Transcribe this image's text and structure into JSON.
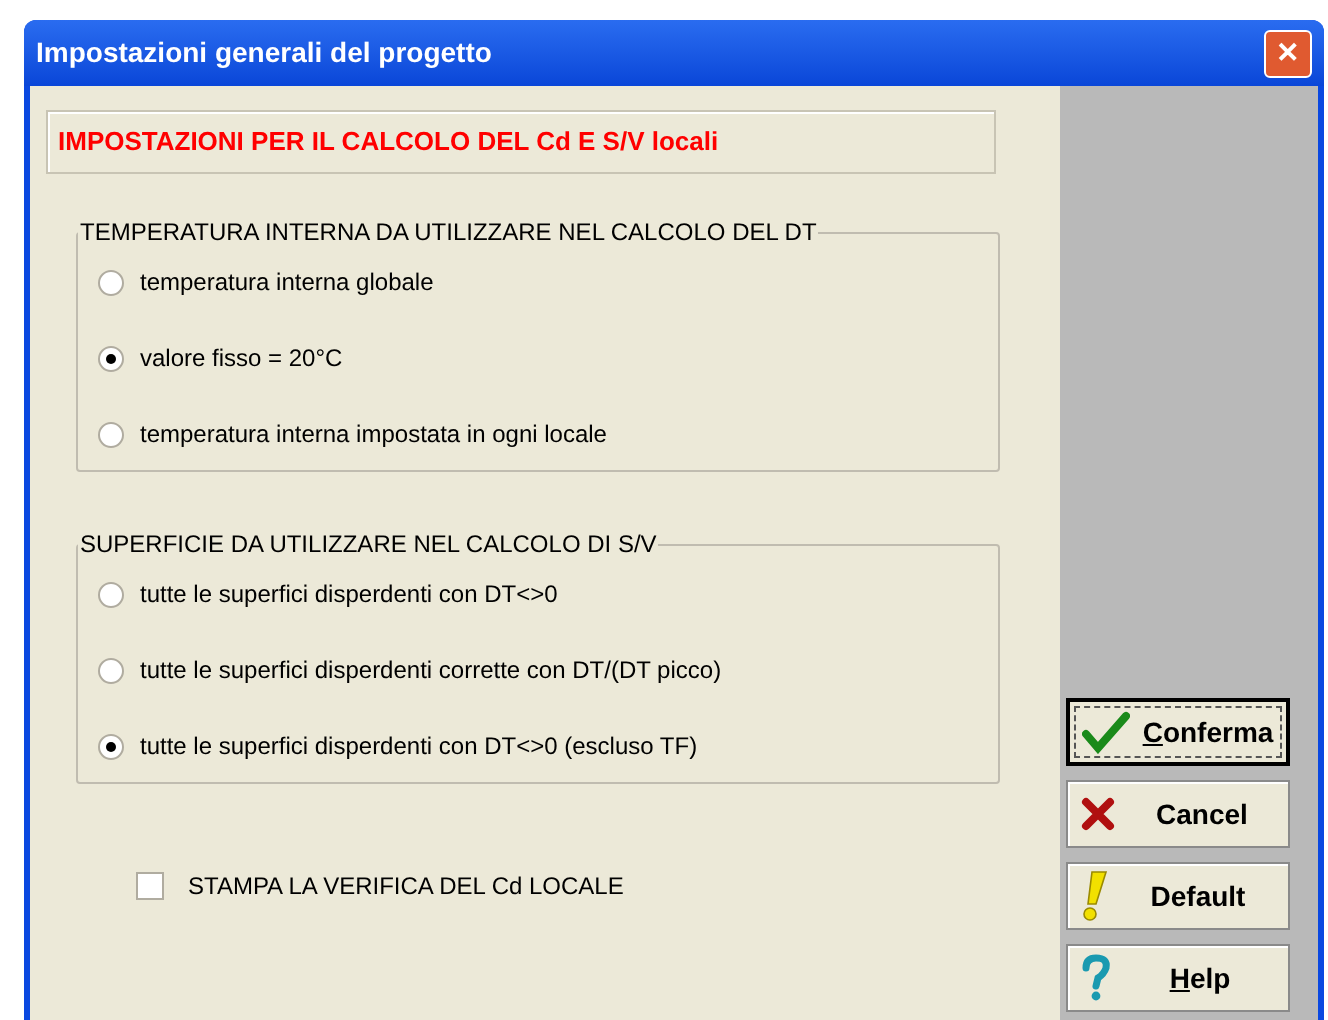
{
  "window": {
    "title": "Impostazioni generali del progetto",
    "close": "✕"
  },
  "header": "IMPOSTAZIONI PER IL CALCOLO DEL Cd E S/V locali",
  "groups": [
    {
      "title": "TEMPERATURA INTERNA DA UTILIZZARE NEL CALCOLO DEL DT",
      "options": [
        {
          "label": "temperatura interna globale",
          "selected": false
        },
        {
          "label": "valore fisso = 20°C",
          "selected": true
        },
        {
          "label": "temperatura interna impostata in ogni locale",
          "selected": false
        }
      ]
    },
    {
      "title": "SUPERFICIE DA UTILIZZARE NEL CALCOLO DI S/V",
      "options": [
        {
          "label": "tutte le superfici disperdenti con DT<>0",
          "selected": false
        },
        {
          "label": "tutte le superfici disperdenti corrette con DT/(DT picco)",
          "selected": false
        },
        {
          "label": "tutte le superfici disperdenti con DT<>0 (escluso TF)",
          "selected": true
        }
      ]
    }
  ],
  "checkbox": {
    "label": "STAMPA LA VERIFICA DEL Cd LOCALE",
    "checked": false
  },
  "buttons": [
    {
      "label": "Conferma",
      "kind": "check",
      "mnemonic": true,
      "focused": true
    },
    {
      "label": "Cancel",
      "kind": "cross",
      "mnemonic": false,
      "focused": false
    },
    {
      "label": "Default",
      "kind": "exclaim",
      "mnemonic": false,
      "focused": false
    },
    {
      "label": "Help",
      "kind": "question",
      "mnemonic": true,
      "focused": false
    }
  ]
}
